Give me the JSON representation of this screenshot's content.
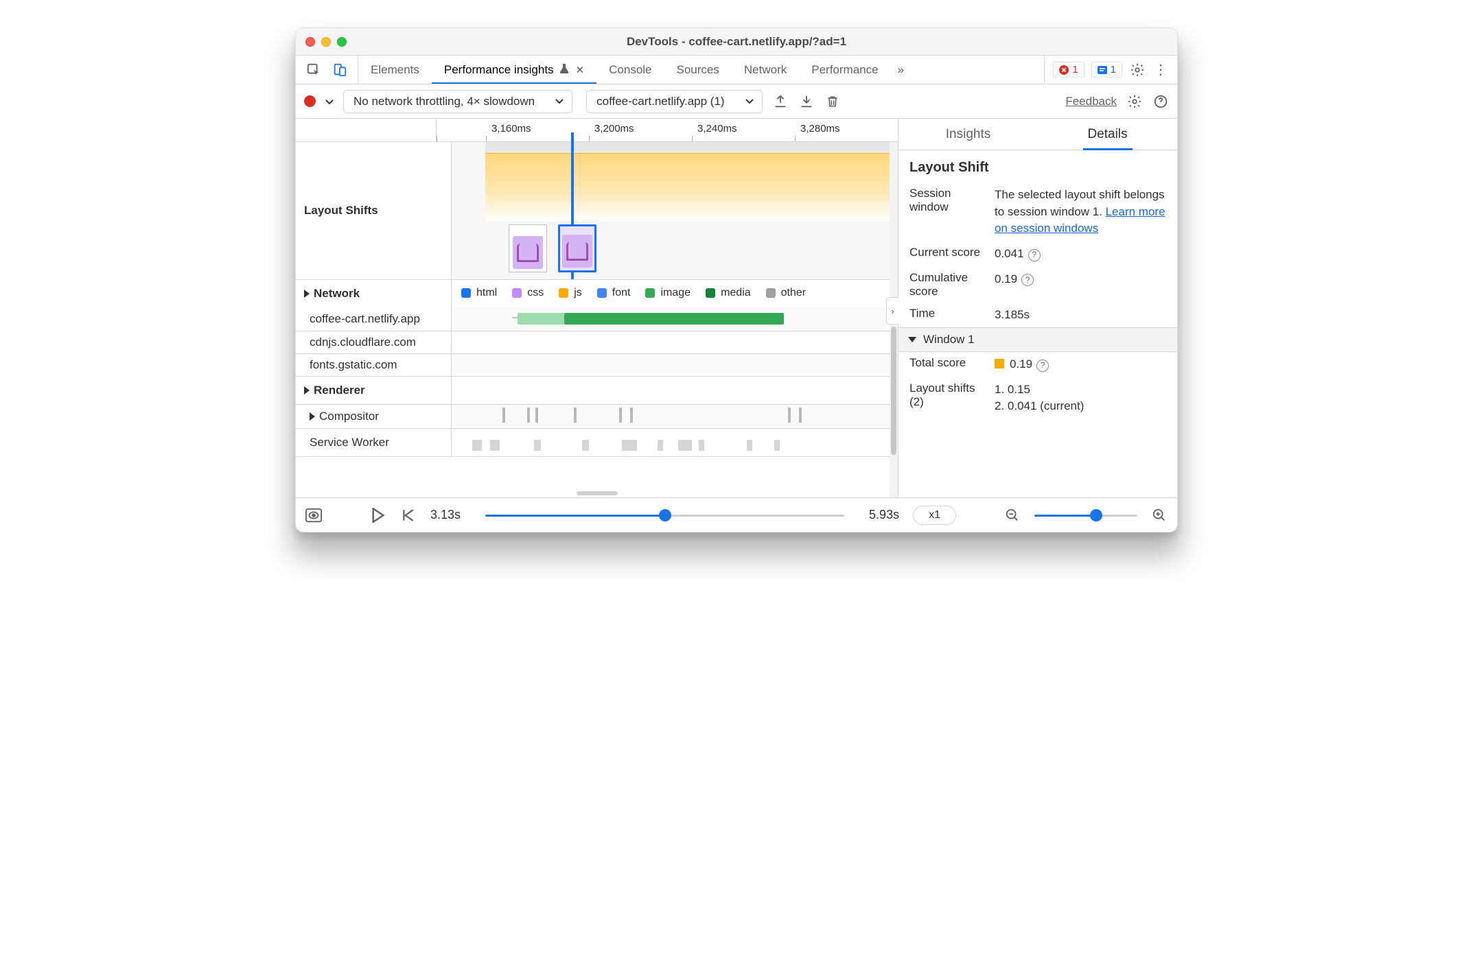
{
  "window": {
    "title": "DevTools - coffee-cart.netlify.app/?ad=1"
  },
  "tabs": {
    "elements": "Elements",
    "perf_insights": "Performance insights",
    "console": "Console",
    "sources": "Sources",
    "network": "Network",
    "performance": "Performance"
  },
  "badges": {
    "errors": "1",
    "issues": "1"
  },
  "toolbar": {
    "throttle": "No network throttling, 4× slowdown",
    "recording": "coffee-cart.netlify.app (1)",
    "feedback": "Feedback"
  },
  "ruler": {
    "t0": "3,160ms",
    "t1": "3,200ms",
    "t2": "3,240ms",
    "t3": "3,280ms"
  },
  "lanes": {
    "layout_shifts": "Layout Shifts",
    "network": "Network",
    "renderer": "Renderer",
    "compositor": "Compositor",
    "service_worker": "Service Worker",
    "hosts": {
      "h0": "coffee-cart.netlify.app",
      "h1": "cdnjs.cloudflare.com",
      "h2": "fonts.gstatic.com"
    }
  },
  "legend": {
    "html": "html",
    "css": "css",
    "js": "js",
    "font": "font",
    "image": "image",
    "media": "media",
    "other": "other"
  },
  "right": {
    "tabs": {
      "insights": "Insights",
      "details": "Details"
    },
    "title": "Layout Shift",
    "session_window_label": "Session window",
    "session_window_text": "The selected layout shift belongs to session window 1. ",
    "learn_more": "Learn more on session windows",
    "current_score_label": "Current score",
    "current_score": "0.041",
    "cumulative_label": "Cumulative score",
    "cumulative": "0.19",
    "time_label": "Time",
    "time": "3.185s",
    "window1": "Window 1",
    "total_score_label": "Total score",
    "total_score": "0.19",
    "layout_shifts_label": "Layout shifts (2)",
    "ls1": "1. 0.15",
    "ls2": "2. 0.041 (current)"
  },
  "footer": {
    "start": "3.13s",
    "end": "5.93s",
    "speed": "x1"
  }
}
